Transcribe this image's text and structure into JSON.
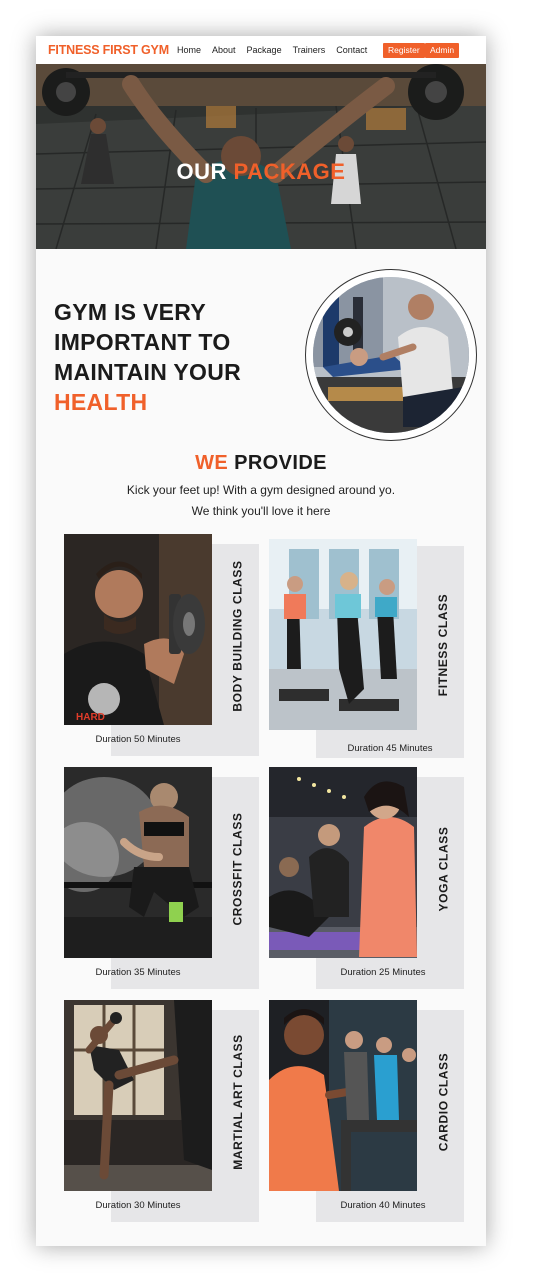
{
  "nav": {
    "brand": "FITNESS FIRST GYM",
    "links": [
      "Home",
      "About",
      "Package",
      "Trainers",
      "Contact"
    ],
    "register": "Register",
    "admin": "Admin"
  },
  "hero": {
    "title_a": "OUR ",
    "title_b": "PACKAGE"
  },
  "intro": {
    "line1": "GYM IS VERY",
    "line2": "IMPORTANT TO",
    "line3": "MAINTAIN YOUR",
    "line4": "HEALTH"
  },
  "provide": {
    "title_a": "WE ",
    "title_b": "PROVIDE",
    "sub1": "Kick your feet up! With a gym designed around yo.",
    "sub2": "We think you'll love it here"
  },
  "packages": [
    {
      "name": "BODY BUILDING CLASS",
      "duration": "Duration 50 Minutes"
    },
    {
      "name": "FITNESS CLASS",
      "duration": "Duration 45 Minutes"
    },
    {
      "name": "CROSSFIT CLASS",
      "duration": "Duration 35 Minutes"
    },
    {
      "name": "YOGA CLASS",
      "duration": "Duration 25 Minutes"
    },
    {
      "name": "MARTIAL ART CLASS",
      "duration": "Duration 30 Minutes"
    },
    {
      "name": "CARDIO CLASS",
      "duration": "Duration 40 Minutes"
    }
  ],
  "colors": {
    "accent": "#f0602a",
    "text": "#1b1b1b",
    "card_bg": "#e6e6e8"
  }
}
